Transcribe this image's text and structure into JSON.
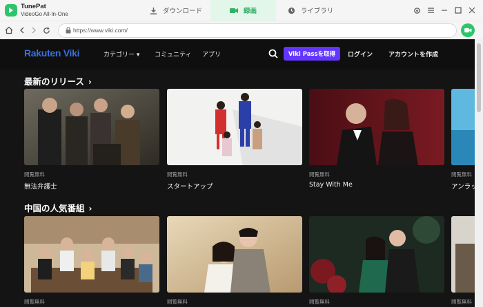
{
  "app": {
    "name": "TunePat",
    "subtitle": "VideoGo All-In-One",
    "tabs": [
      {
        "label": "ダウンロード",
        "icon": "download-icon"
      },
      {
        "label": "録画",
        "icon": "camera-icon"
      },
      {
        "label": "ライブラリ",
        "icon": "clock-icon"
      }
    ],
    "accent_color": "#2fc46b"
  },
  "browser": {
    "url": "https://www.viki.com/"
  },
  "site": {
    "brand_part1": "Rakuten",
    "brand_part2": "Viki",
    "nav": {
      "category": "カテゴリー ▾",
      "community": "コミュニティ",
      "apps": "アプリ"
    },
    "pass_button": "Viki Passを取得",
    "login": "ログイン",
    "signup": "アカウントを作成",
    "sections": [
      {
        "title": "最新のリリース",
        "chevron": "›",
        "cards": [
          {
            "meta": "閲覧無料",
            "title": "無法弁護士"
          },
          {
            "meta": "閲覧無料",
            "title": "スタートアップ"
          },
          {
            "meta": "閲覧無料",
            "title": "Stay With Me"
          },
          {
            "meta": "閲覧無料",
            "title": "アンラッ"
          }
        ]
      },
      {
        "title": "中国の人気番組",
        "chevron": "›",
        "cards": [
          {
            "meta": "閲覧無料",
            "title": ""
          },
          {
            "meta": "閲覧無料",
            "title": ""
          },
          {
            "meta": "閲覧無料",
            "title": ""
          },
          {
            "meta": "閲覧無料",
            "title": ""
          }
        ]
      }
    ],
    "pass_color": "#6236ff",
    "brand_color": "#3b6fe0"
  }
}
